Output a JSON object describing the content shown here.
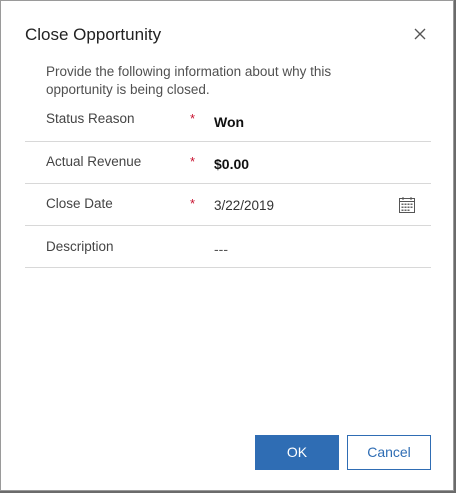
{
  "dialog": {
    "title": "Close Opportunity",
    "description": "Provide the following information about why this opportunity is being closed."
  },
  "fields": {
    "status_reason": {
      "label": "Status Reason",
      "required_mark": "*",
      "value": "Won"
    },
    "actual_revenue": {
      "label": "Actual Revenue",
      "required_mark": "*",
      "value": "$0.00"
    },
    "close_date": {
      "label": "Close Date",
      "required_mark": "*",
      "value": "3/22/2019",
      "icon": "calendar-icon"
    },
    "description": {
      "label": "Description",
      "value": "---"
    }
  },
  "buttons": {
    "ok_label": "OK",
    "cancel_label": "Cancel"
  },
  "colors": {
    "accent": "#2f6db4",
    "required": "#c8102e"
  }
}
